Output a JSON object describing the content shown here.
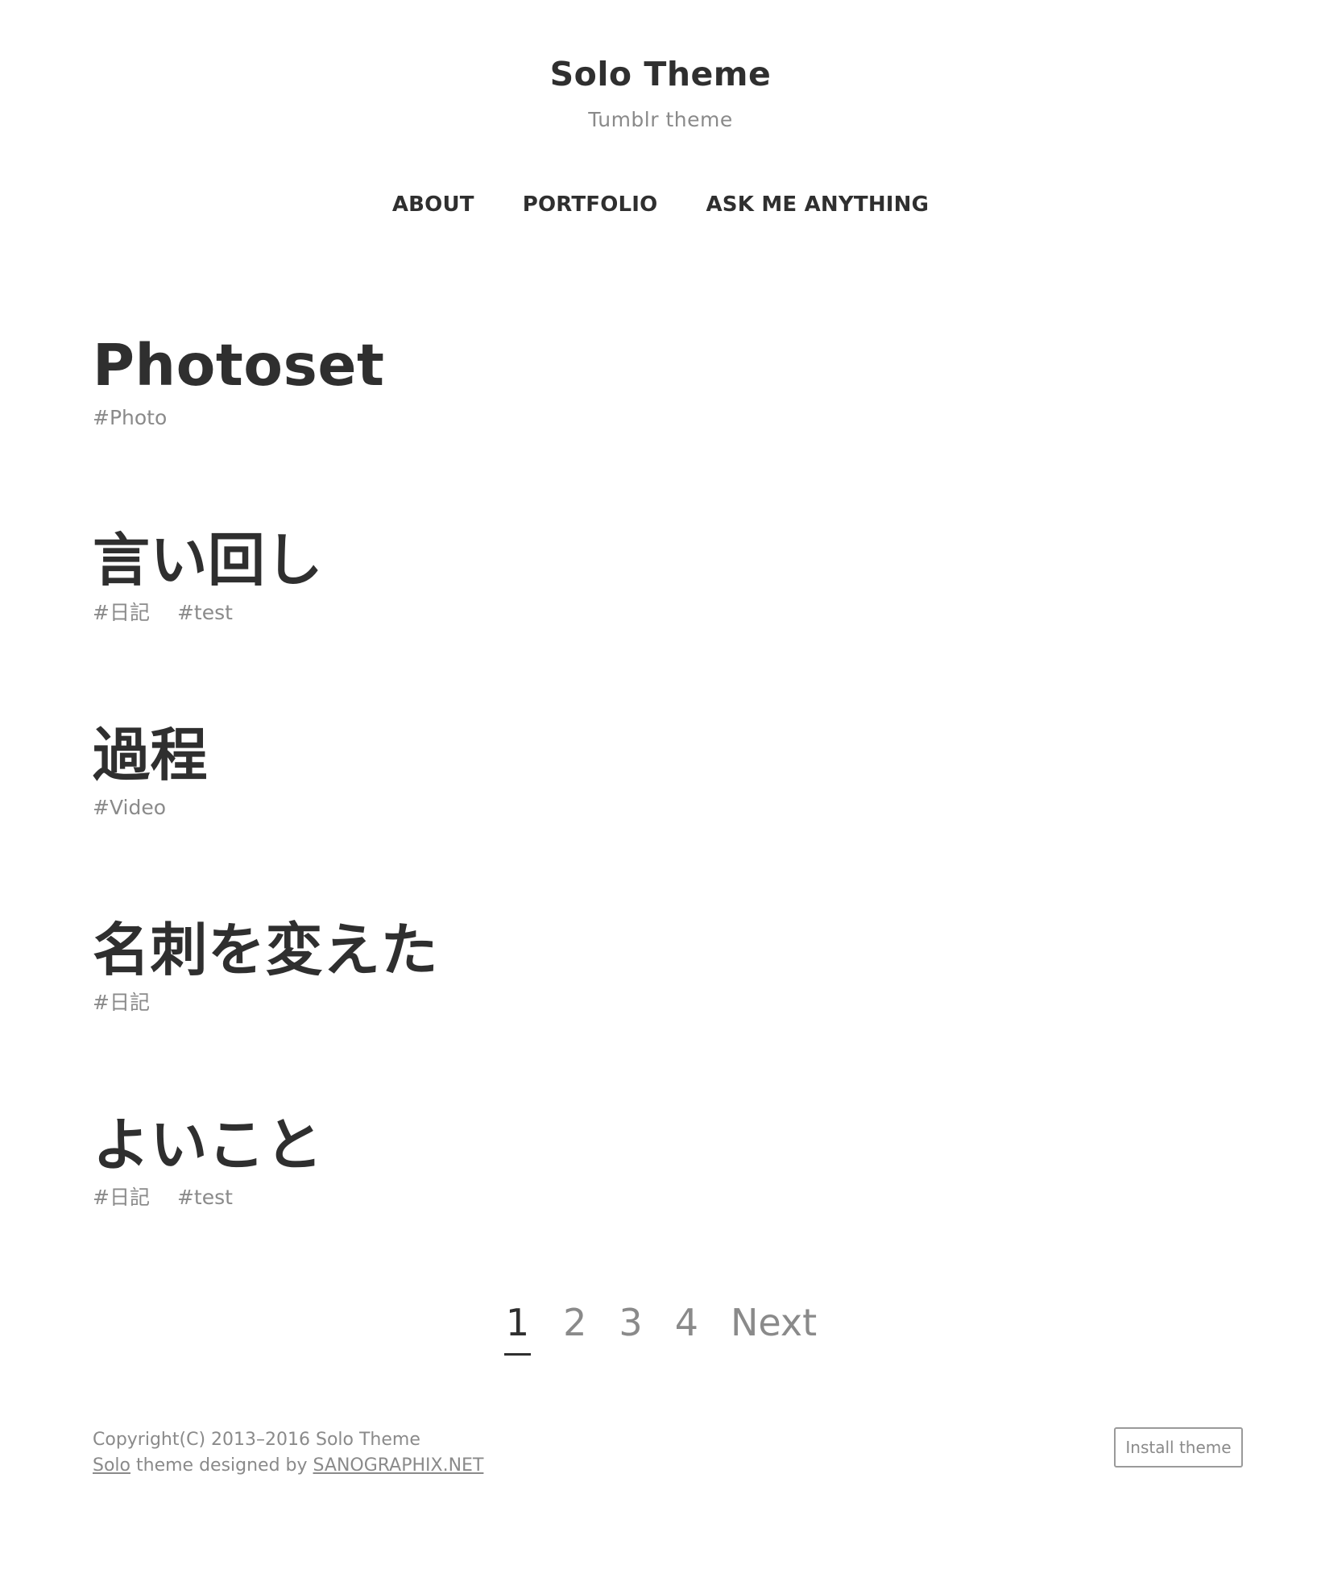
{
  "site": {
    "title": "Solo Theme",
    "description": "Tumblr theme"
  },
  "nav": {
    "items": [
      "ABOUT",
      "PORTFOLIO",
      "ASK ME ANYTHING"
    ]
  },
  "posts": [
    {
      "title": "Photoset",
      "tags": [
        "#Photo"
      ]
    },
    {
      "title": "言い回し",
      "tags": [
        "#日記",
        "#test"
      ]
    },
    {
      "title": "過程",
      "tags": [
        "#Video"
      ]
    },
    {
      "title": "名刺を変えた",
      "tags": [
        "#日記"
      ]
    },
    {
      "title": "よいこと",
      "tags": [
        "#日記",
        "#test"
      ]
    }
  ],
  "pagination": {
    "pages": [
      "1",
      "2",
      "3",
      "4"
    ],
    "current": "1",
    "next_label": "Next"
  },
  "footer": {
    "copyright": "Copyright(C) 2013–2016 Solo Theme",
    "theme_link": "Solo",
    "designed_by_text": "theme designed by",
    "designer_link": "SANOGRAPHIX.NET",
    "install_label": "Install theme"
  },
  "colors": {
    "text": "#2f2f2f",
    "muted": "#8a8a8a",
    "background": "#ffffff"
  }
}
